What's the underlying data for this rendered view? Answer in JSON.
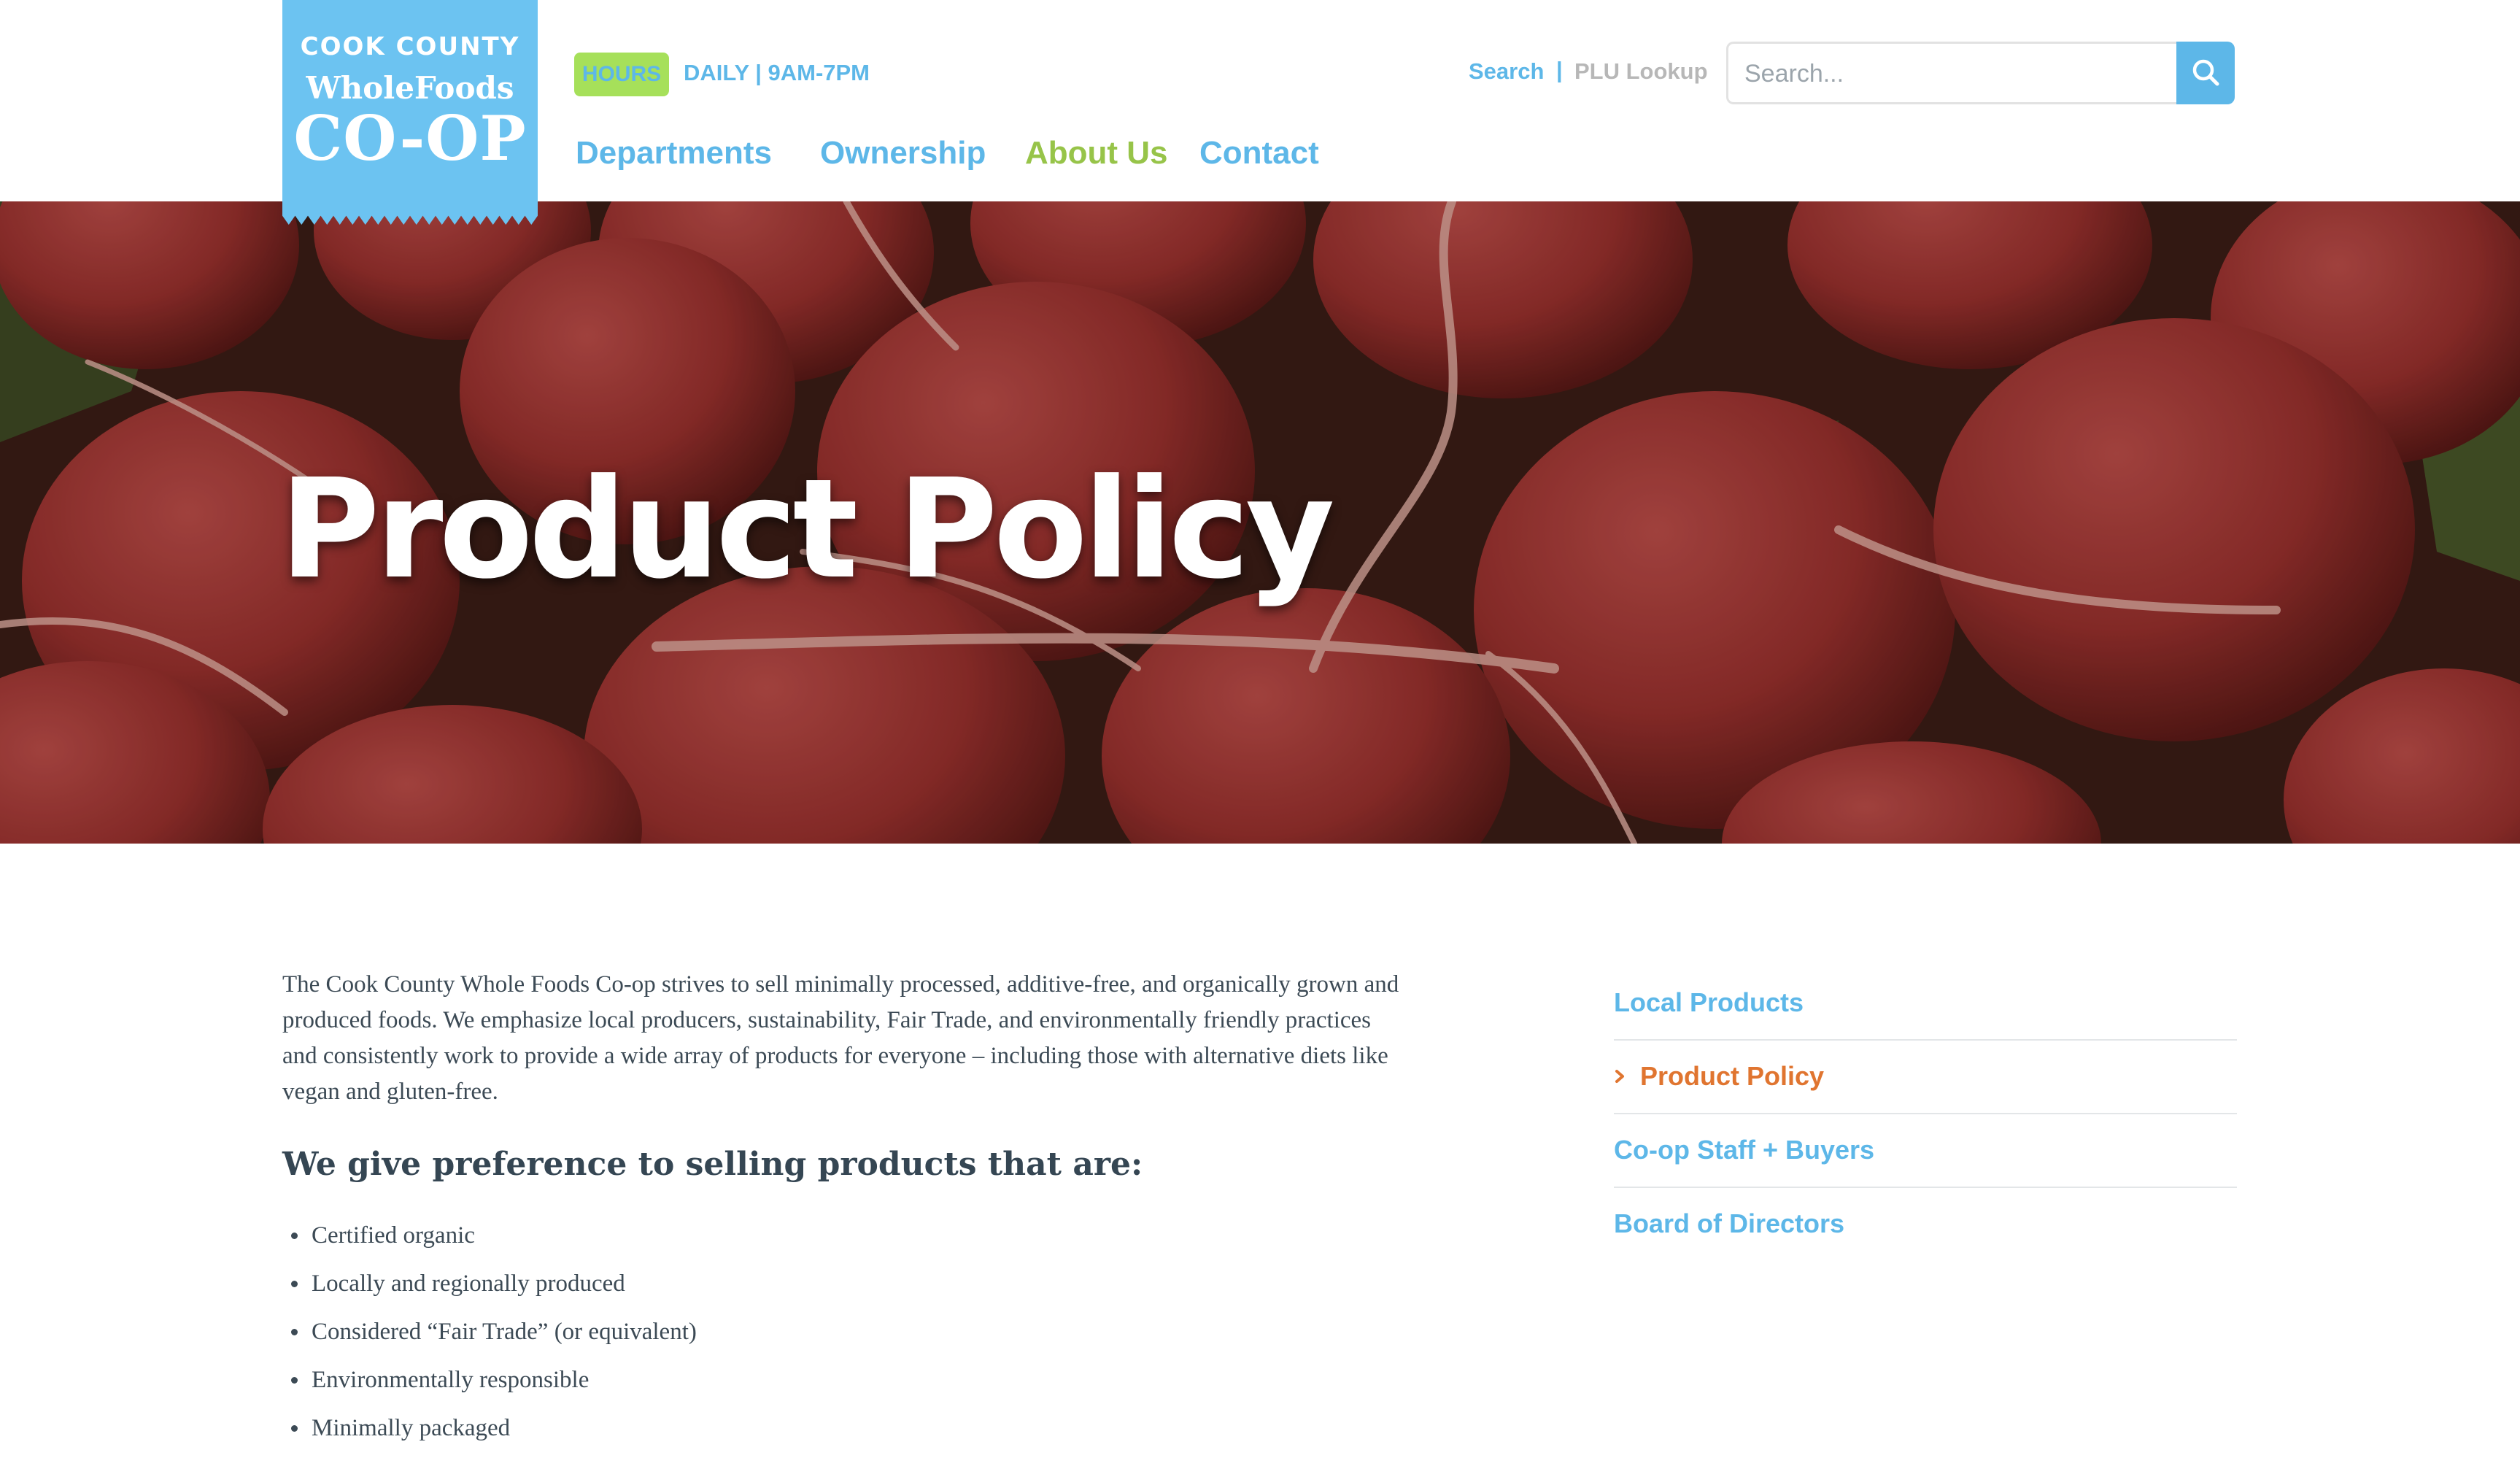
{
  "brand": {
    "line1": "COOK COUNTY",
    "line2": "WholeFoods",
    "line3": "CO-OP"
  },
  "hours": {
    "badge": "HOURS",
    "text": "DAILY | 9AM-7PM"
  },
  "nav": {
    "items": [
      {
        "label": "Departments"
      },
      {
        "label": "Ownership"
      },
      {
        "label": "About Us"
      },
      {
        "label": "Contact"
      }
    ],
    "active_color": "#97c449",
    "link_color": "#5db7e8"
  },
  "utility": {
    "search_label": "Search",
    "separator": "|",
    "plu_label": "PLU Lookup"
  },
  "search": {
    "placeholder": "Search...",
    "button_icon": "search-icon"
  },
  "hero": {
    "title": "Product Policy"
  },
  "main": {
    "intro": "The Cook County Whole Foods Co-op strives to sell minimally processed, additive-free, and organically grown and produced foods. We emphasize local producers, sustainability, Fair Trade, and environmentally friendly practices and consistently work to provide a wide array of products for everyone – including those with alternative diets like vegan and gluten-free.",
    "heading": "We give preference to selling products that are:",
    "bullets": [
      "Certified organic",
      "Locally and regionally produced",
      "Considered “Fair Trade” (or equivalent)",
      "Environmentally responsible",
      "Minimally packaged"
    ]
  },
  "sidebar": {
    "items": [
      {
        "label": "Local Products",
        "active": false
      },
      {
        "label": "Product Policy",
        "active": true
      },
      {
        "label": "Co-op Staff + Buyers",
        "active": false
      },
      {
        "label": "Board of Directors",
        "active": false
      }
    ],
    "active_icon": "chevron-right-icon",
    "active_color": "#e07530"
  }
}
